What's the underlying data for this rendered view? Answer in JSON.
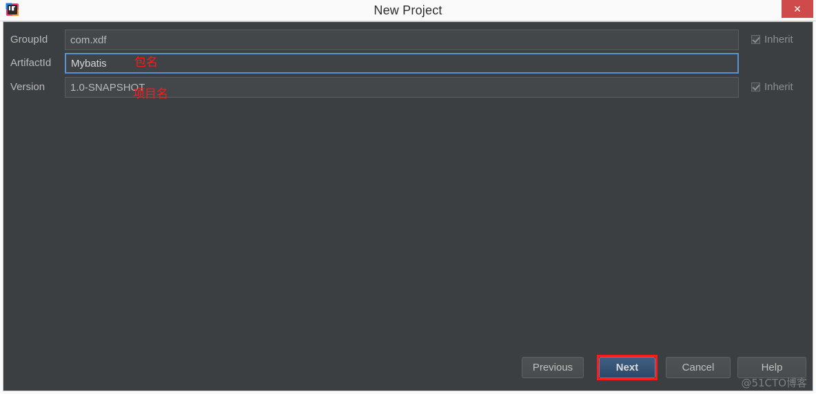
{
  "window": {
    "title": "New Project",
    "app_icon": "intellij-idea-logo",
    "close_label": "✕",
    "colors": {
      "titlebar_bg": "#fafafa",
      "dialog_bg": "#3c3f41",
      "field_bg": "#43474a",
      "focus_border": "#5a93cf",
      "close_button": "#cf4b4b",
      "default_button": "#2c4868",
      "annotation_red": "#ff1a1a",
      "label_text": "#bbbbbb"
    }
  },
  "form": {
    "rows": [
      {
        "label": "GroupId",
        "value": "com.xdf",
        "placeholder": "",
        "focused": false,
        "inherit_label": "Inherit",
        "inherit_checked": true,
        "inherit_visible": true
      },
      {
        "label": "ArtifactId",
        "value": "Mybatis",
        "placeholder": "",
        "focused": true,
        "inherit_label": "Inherit",
        "inherit_checked": false,
        "inherit_visible": false
      },
      {
        "label": "Version",
        "value": "1.0-SNAPSHOT",
        "placeholder": "",
        "focused": false,
        "inherit_label": "Inherit",
        "inherit_checked": true,
        "inherit_visible": true
      }
    ]
  },
  "annotations": [
    {
      "text": "包名",
      "target": "groupid"
    },
    {
      "text": "项目名",
      "target": "artifactid"
    }
  ],
  "buttons": {
    "previous": "Previous",
    "next": "Next",
    "cancel": "Cancel",
    "help": "Help",
    "highlighted": "next"
  },
  "watermark": "@51CTO博客"
}
